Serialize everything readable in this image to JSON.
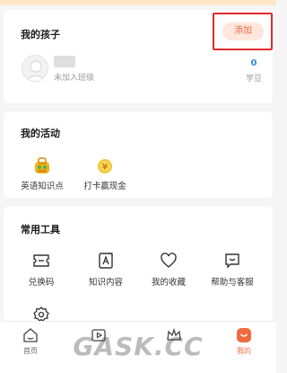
{
  "children_section": {
    "title": "我的孩子",
    "add_label": "添加",
    "child_status": "未加入班级",
    "beans_count": "0",
    "beans_label": "学豆"
  },
  "activity_section": {
    "title": "我的活动",
    "items": [
      {
        "label": "英语知识点",
        "icon": "book-bag-icon"
      },
      {
        "label": "打卡赢现金",
        "icon": "coin-money-bag-icon"
      }
    ]
  },
  "tools_section": {
    "title": "常用工具",
    "items": [
      {
        "label": "兑换码",
        "icon": "ticket-icon"
      },
      {
        "label": "知识内容",
        "icon": "document-a-icon"
      },
      {
        "label": "我的收藏",
        "icon": "heart-icon"
      },
      {
        "label": "帮助与客服",
        "icon": "chat-icon"
      }
    ],
    "extra_icon": "settings-gear-icon"
  },
  "bottom_nav": {
    "items": [
      {
        "label": "首页",
        "icon": "home-icon"
      },
      {
        "label": "",
        "icon": "play-icon"
      },
      {
        "label": "",
        "icon": "crown-icon"
      },
      {
        "label": "我的",
        "icon": "profile-icon"
      }
    ],
    "active_index": 3
  },
  "watermark": "GASK.CC",
  "colors": {
    "accent": "#f06a40",
    "accent_bg": "#fde6dc",
    "highlight_border": "#e02b2b",
    "beans_blue": "#2a8fe0",
    "background": "#f5f5f5"
  }
}
